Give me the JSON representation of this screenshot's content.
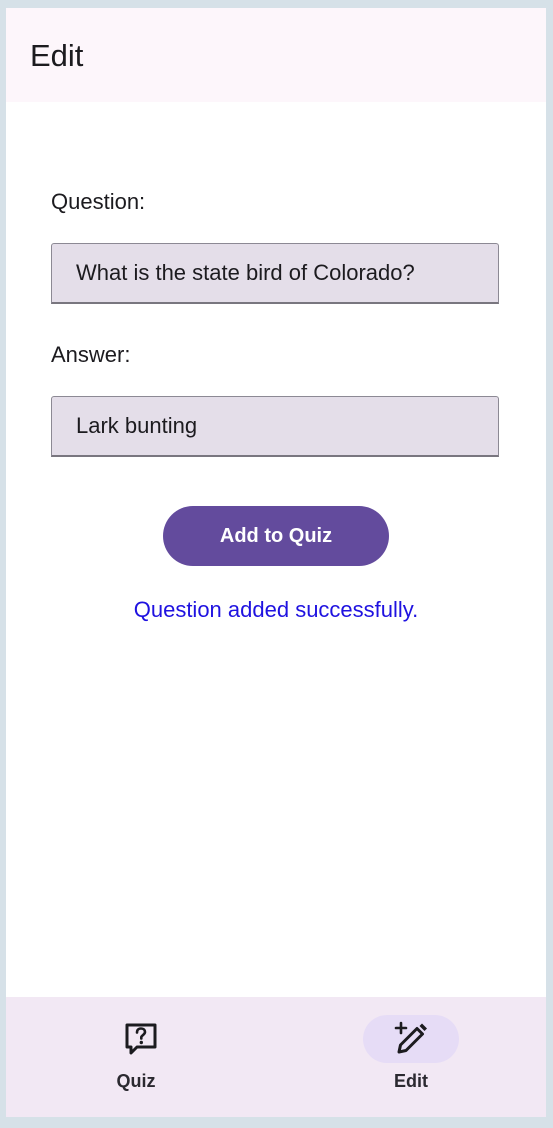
{
  "header": {
    "title": "Edit"
  },
  "form": {
    "question_label": "Question:",
    "question_value": "What is the state bird of Colorado?",
    "answer_label": "Answer:",
    "answer_value": "Lark bunting",
    "submit_label": "Add to Quiz",
    "status_message": "Question added successfully."
  },
  "bottom_nav": {
    "items": [
      {
        "label": "Quiz",
        "icon": "quiz-question-bubble-icon",
        "active": false
      },
      {
        "label": "Edit",
        "icon": "edit-pencil-plus-icon",
        "active": true
      }
    ]
  },
  "colors": {
    "primary": "#634b9d",
    "status": "#1f12e0",
    "nav_background": "#f2e8f4",
    "nav_active_indicator": "#e6dcf6",
    "input_fill": "#e4dee9"
  }
}
